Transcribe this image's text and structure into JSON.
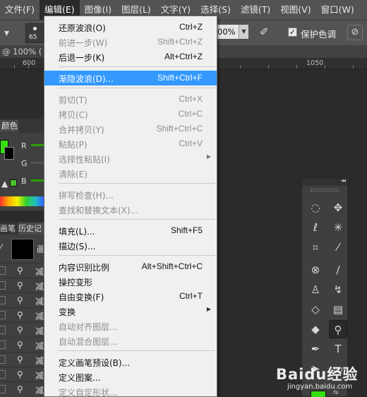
{
  "menubar": {
    "items": [
      "文件(F)",
      "编辑(E)",
      "图像(I)",
      "图层(L)",
      "文字(Y)",
      "选择(S)",
      "滤镜(T)",
      "视图(V)",
      "窗口(W)"
    ],
    "active_index": 1
  },
  "options_bar": {
    "brush_size": "65",
    "flow_value": "00%",
    "protect_color_label": "保护色调",
    "protect_color_checked": true
  },
  "document_tab": {
    "title": "@ 100% ("
  },
  "ruler": {
    "labels": [
      "600",
      "1050"
    ]
  },
  "color_panel": {
    "tab_label": "颜色",
    "channels": [
      "R",
      "G",
      "B"
    ],
    "foreground_color": "#33e00e",
    "background_color": "#000000"
  },
  "history_panel": {
    "tabs": [
      "画笔",
      "历史记"
    ],
    "snapshot_name": "画",
    "row_label": "减",
    "row_count": 9
  },
  "tools_panel": {
    "collapse_glyph": "◂◂",
    "foreground_color": "#33e00e"
  },
  "edit_menu": {
    "items": [
      {
        "label": "还原波浪(O)",
        "shortcut": "Ctrl+Z",
        "enabled": true
      },
      {
        "label": "前进一步(W)",
        "shortcut": "Shift+Ctrl+Z",
        "enabled": false
      },
      {
        "label": "后退一步(K)",
        "shortcut": "Alt+Ctrl+Z",
        "enabled": true
      },
      {
        "label": "渐隐波浪(D)...",
        "shortcut": "Shift+Ctrl+F",
        "enabled": true,
        "highlighted": true
      },
      {
        "label": "剪切(T)",
        "shortcut": "Ctrl+X",
        "enabled": false
      },
      {
        "label": "拷贝(C)",
        "shortcut": "Ctrl+C",
        "enabled": false
      },
      {
        "label": "合并拷贝(Y)",
        "shortcut": "Shift+Ctrl+C",
        "enabled": false
      },
      {
        "label": "粘贴(P)",
        "shortcut": "Ctrl+V",
        "enabled": false
      },
      {
        "label": "选择性粘贴(I)",
        "shortcut": "",
        "enabled": false,
        "submenu": true
      },
      {
        "label": "清除(E)",
        "shortcut": "",
        "enabled": false
      },
      {
        "label": "拼写检查(H)...",
        "shortcut": "",
        "enabled": false
      },
      {
        "label": "查找和替换文本(X)...",
        "shortcut": "",
        "enabled": false
      },
      {
        "label": "填充(L)...",
        "shortcut": "Shift+F5",
        "enabled": true
      },
      {
        "label": "描边(S)...",
        "shortcut": "",
        "enabled": true
      },
      {
        "label": "内容识别比例",
        "shortcut": "Alt+Shift+Ctrl+C",
        "enabled": true
      },
      {
        "label": "操控变形",
        "shortcut": "",
        "enabled": true
      },
      {
        "label": "自由变换(F)",
        "shortcut": "Ctrl+T",
        "enabled": true
      },
      {
        "label": "变换",
        "shortcut": "",
        "enabled": true,
        "submenu": true
      },
      {
        "label": "自动对齐图层...",
        "shortcut": "",
        "enabled": false
      },
      {
        "label": "自动混合图层...",
        "shortcut": "",
        "enabled": false
      },
      {
        "label": "定义画笔预设(B)...",
        "shortcut": "",
        "enabled": true
      },
      {
        "label": "定义图案...",
        "shortcut": "",
        "enabled": true
      },
      {
        "label": "定义自定形状...",
        "shortcut": "",
        "enabled": false
      }
    ]
  },
  "watermark": {
    "logo": "Baidu经验",
    "url": "jingyan.baidu.com"
  }
}
